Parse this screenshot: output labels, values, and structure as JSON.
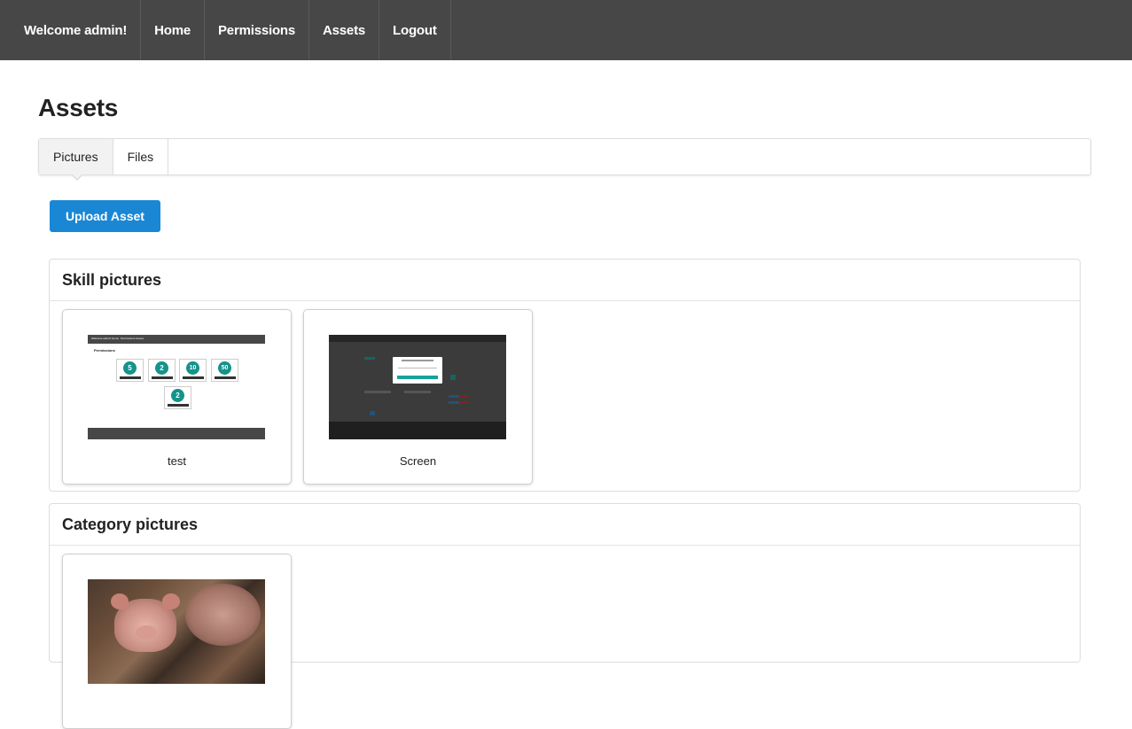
{
  "nav": {
    "welcome": "Welcome admin!",
    "items": [
      {
        "label": "Home"
      },
      {
        "label": "Permissions"
      },
      {
        "label": "Assets"
      },
      {
        "label": "Logout"
      }
    ]
  },
  "page": {
    "title": "Assets"
  },
  "tabs": [
    {
      "label": "Pictures",
      "active": true
    },
    {
      "label": "Files",
      "active": false
    }
  ],
  "upload_button": "Upload Asset",
  "colors": {
    "nav_bg": "#474747",
    "primary": "#1a87d4",
    "teal": "#15938a"
  },
  "sections": [
    {
      "title": "Skill pictures",
      "items": [
        {
          "caption": "test",
          "thumb": {
            "nav": [
              "Welcome admin!",
              "Home",
              "Permissions",
              "Assets"
            ],
            "title": "Permissions",
            "badges": [
              "5",
              "2",
              "10",
              "50",
              "2"
            ]
          }
        },
        {
          "caption": "Screen"
        }
      ]
    },
    {
      "title": "Category pictures",
      "items": [
        {
          "caption": ""
        }
      ]
    }
  ]
}
